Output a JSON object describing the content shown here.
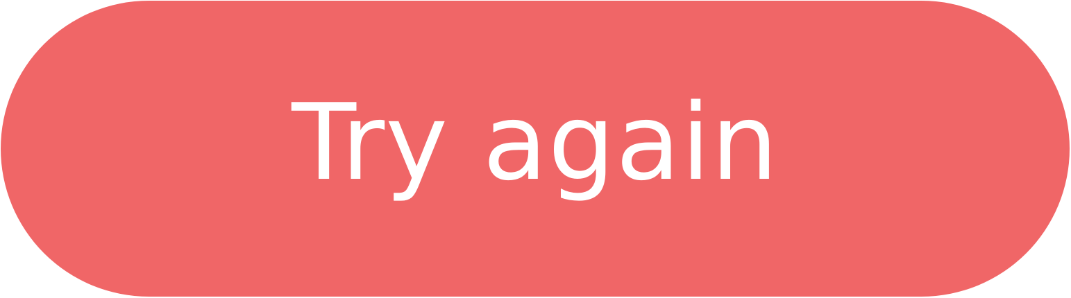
{
  "button": {
    "label": "Try again",
    "background_color": "#F06667",
    "text_color": "#FFFFFF"
  }
}
